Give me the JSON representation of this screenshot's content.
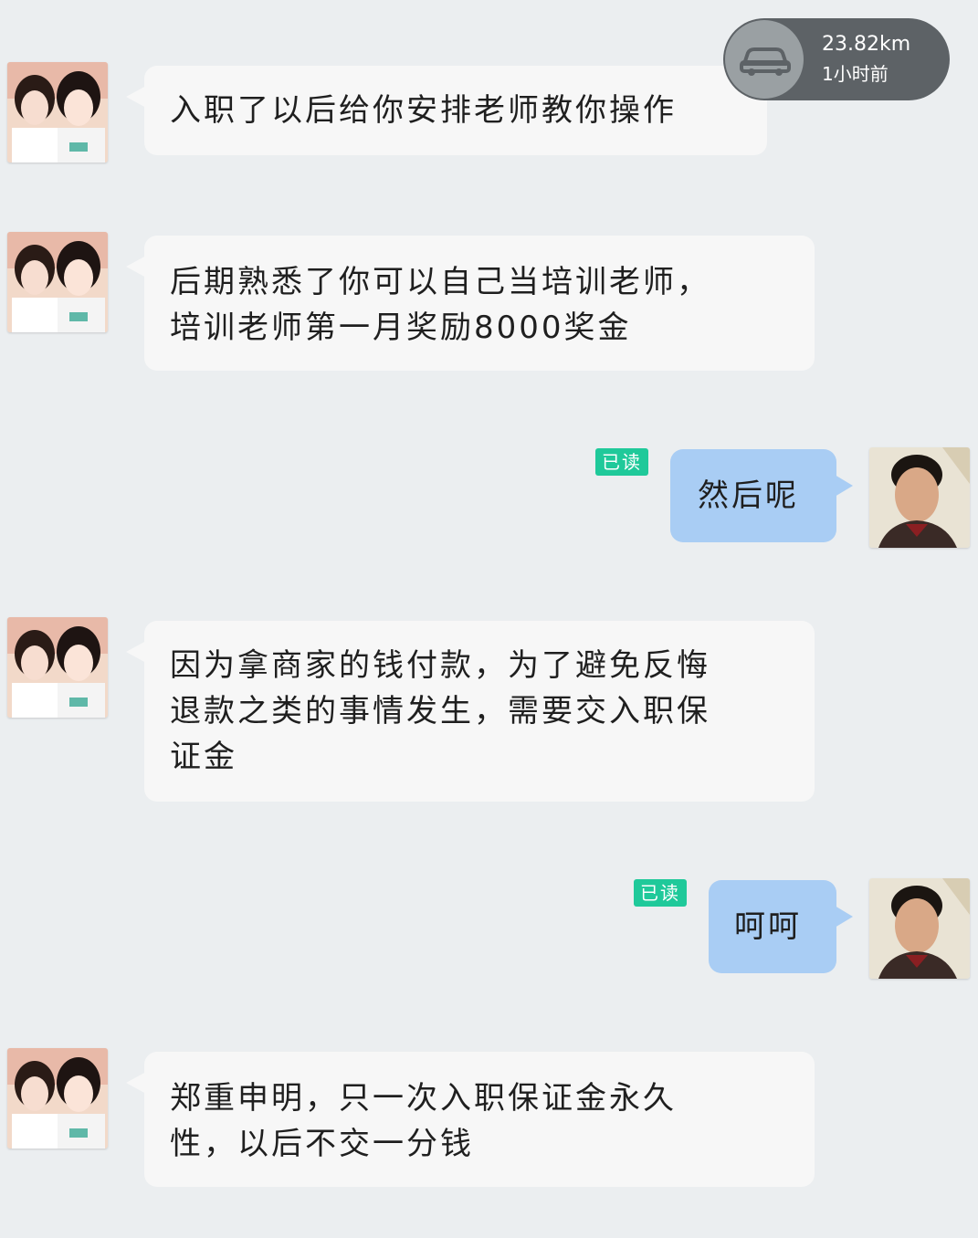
{
  "distance_badge": {
    "distance": "23.82km",
    "time": "1小时前",
    "icon": "car-icon"
  },
  "messages": [
    {
      "side": "left",
      "text": "入职了以后给你安排老师教你操作"
    },
    {
      "side": "left",
      "text": "后期熟悉了你可以自己当培训老师，\n培训老师第一月奖励8000奖金"
    },
    {
      "side": "right",
      "text": "然后呢",
      "read": "已读"
    },
    {
      "side": "left",
      "text": "因为拿商家的钱付款，为了避免反悔\n退款之类的事情发生，需要交入职保\n证金"
    },
    {
      "side": "right",
      "text": "呵呵",
      "read": "已读"
    },
    {
      "side": "left",
      "text": "郑重申明，只一次入职保证金永久\n性，以后不交一分钱"
    }
  ]
}
